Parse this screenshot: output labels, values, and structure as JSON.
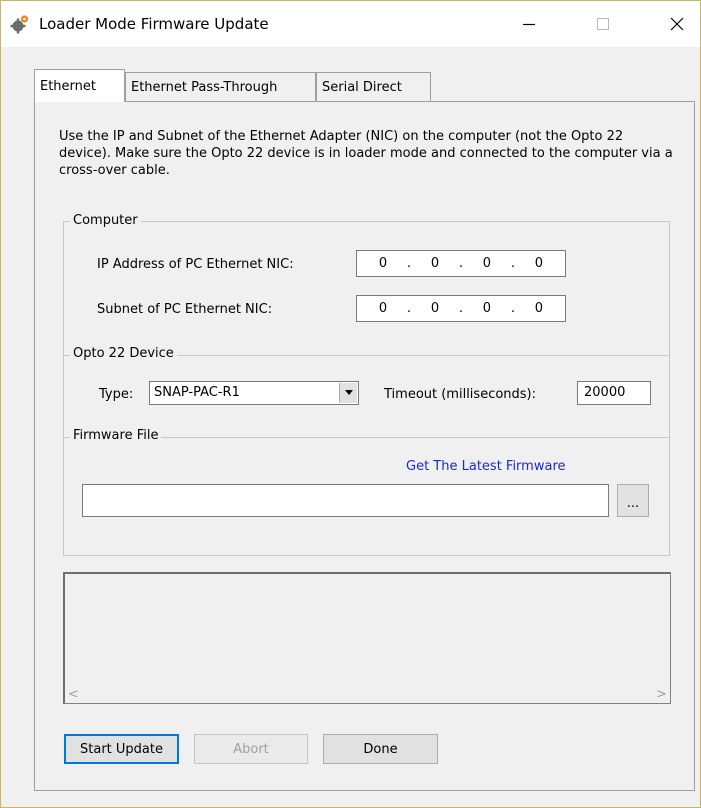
{
  "window": {
    "title": "Loader Mode Firmware Update",
    "icon": "gear-icon",
    "controls": {
      "minimize": "minimize-icon",
      "maximize": "maximize-icon",
      "close": "close-icon"
    }
  },
  "tabs": [
    {
      "label": "Ethernet",
      "active": true
    },
    {
      "label": "Ethernet Pass-Through",
      "active": false
    },
    {
      "label": "Serial Direct",
      "active": false
    }
  ],
  "description": "Use the IP and Subnet of the Ethernet Adapter (NIC) on the computer (not the Opto 22 device). Make sure the Opto 22 device is in loader mode and connected to the computer via a cross-over cable.",
  "computer": {
    "legend": "Computer",
    "ip_label": "IP Address of PC Ethernet NIC:",
    "ip_octets": [
      "0",
      "0",
      "0",
      "0"
    ],
    "subnet_label": "Subnet of PC Ethernet NIC:",
    "subnet_octets": [
      "0",
      "0",
      "0",
      "0"
    ],
    "dot": "."
  },
  "device": {
    "legend": "Opto 22 Device",
    "type_label": "Type:",
    "type_value": "SNAP-PAC-R1",
    "timeout_label": "Timeout (milliseconds):",
    "timeout_value": "20000"
  },
  "firmware": {
    "legend": "Firmware File",
    "link": "Get The Latest Firmware",
    "path_value": "",
    "browse_label": "..."
  },
  "log": {
    "scroll_left": "<",
    "scroll_right": ">"
  },
  "buttons": {
    "start": "Start Update",
    "abort": "Abort",
    "done": "Done"
  },
  "colors": {
    "link": "#1a2ccc",
    "focus_border": "#0078d7",
    "disabled_text": "#a0a0a0"
  }
}
